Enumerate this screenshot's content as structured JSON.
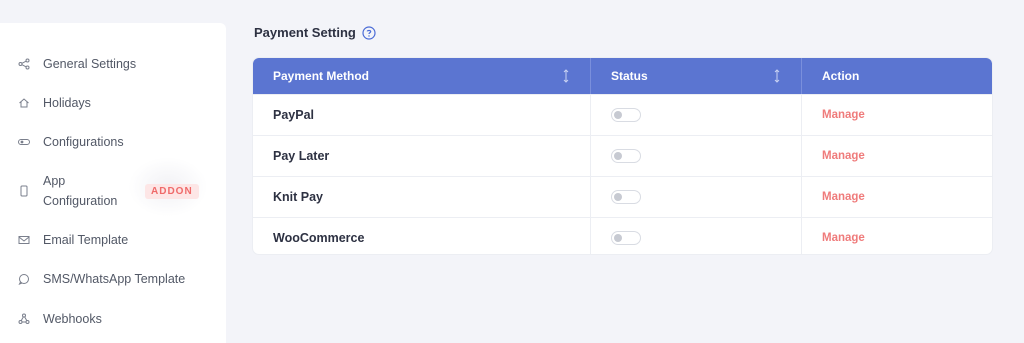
{
  "sidebar": {
    "items": [
      {
        "label": "General Settings",
        "icon": "share-nodes-icon"
      },
      {
        "label": "Holidays",
        "icon": "home-icon"
      },
      {
        "label": "Configurations",
        "icon": "toggle-icon"
      },
      {
        "label": "App Configuration",
        "icon": "mobile-icon",
        "badge": "ADDON"
      },
      {
        "label": "Email Template",
        "icon": "envelope-icon"
      },
      {
        "label": "SMS/WhatsApp Template",
        "icon": "chat-bubble-icon"
      },
      {
        "label": "Webhooks",
        "icon": "webhook-icon"
      }
    ]
  },
  "page": {
    "title": "Payment Setting",
    "help_icon": "question-circle-icon"
  },
  "table": {
    "headers": [
      "Payment Method",
      "Status",
      "Action"
    ],
    "rows": [
      {
        "method": "PayPal",
        "enabled": false,
        "action": "Manage"
      },
      {
        "method": "Pay Later",
        "enabled": false,
        "action": "Manage"
      },
      {
        "method": "Knit Pay",
        "enabled": false,
        "action": "Manage"
      },
      {
        "method": "WooCommerce",
        "enabled": false,
        "action": "Manage"
      }
    ]
  },
  "colors": {
    "header_bg": "#5b75d1",
    "action_link": "#ef7b7b",
    "badge_text": "#ef6a6a",
    "badge_bg": "#fde6e6",
    "page_bg": "#f3f4f9"
  }
}
